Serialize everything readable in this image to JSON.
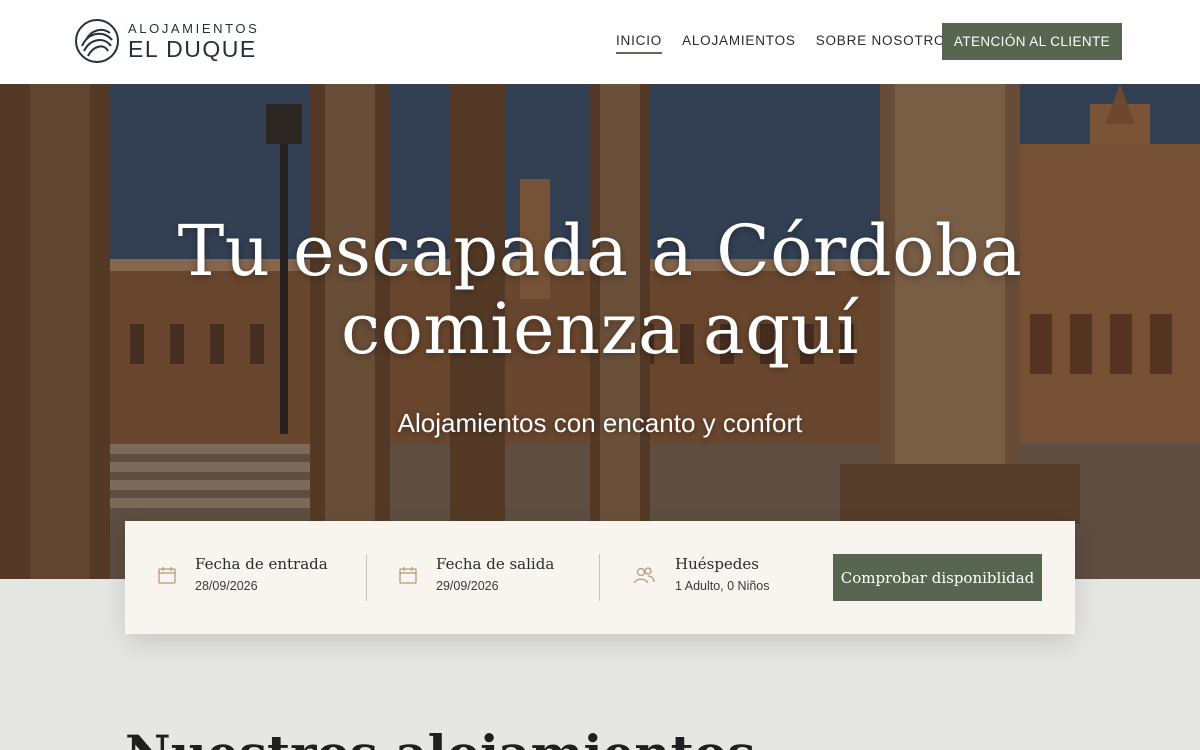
{
  "logo": {
    "top": "ALOJAMIENTOS",
    "bottom": "EL DUQUE"
  },
  "nav": {
    "items": [
      {
        "label": "INICIO",
        "active": true
      },
      {
        "label": "ALOJAMIENTOS",
        "active": false
      },
      {
        "label": "SOBRE NOSOTROS",
        "active": false
      }
    ],
    "cta": "ATENCIÓN AL CLIENTE"
  },
  "hero": {
    "title_line1": "Tu escapada a Córdoba",
    "title_line2": "comienza aquí",
    "subtitle": "Alojamientos con encanto y confort"
  },
  "booking": {
    "checkin": {
      "label": "Fecha de entrada",
      "value": "28/09/2026",
      "icon": "calendar-icon"
    },
    "checkout": {
      "label": "Fecha de salida",
      "value": "29/09/2026",
      "icon": "calendar-icon"
    },
    "guests": {
      "label": "Huéspedes",
      "value": "1 Adulto, 0 Niños",
      "icon": "users-icon"
    },
    "button": "Comprobar disponiblidad"
  },
  "section": {
    "title": "Nuestros alojamientos"
  },
  "colors": {
    "accent": "#576551",
    "header_bg": "#ffffff",
    "booking_bg": "#f8f5f1",
    "page_bg": "#e6e6e3"
  }
}
